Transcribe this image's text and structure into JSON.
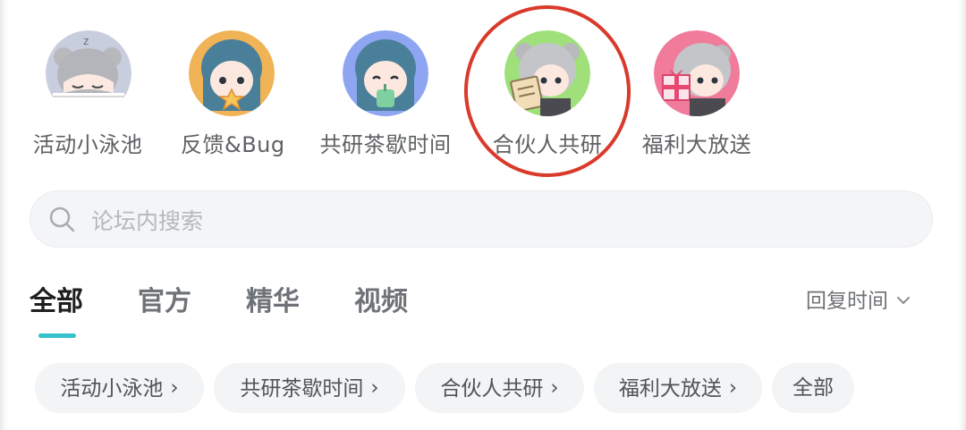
{
  "categories": [
    {
      "label": "活动小泳池",
      "icon": "avatar-sleeping-character",
      "bg": "#c9cede"
    },
    {
      "label": "反馈&Bug",
      "icon": "avatar-character-holding-star",
      "bg": "#f0b355"
    },
    {
      "label": "共研茶歇时间",
      "icon": "avatar-character-drinking-tea",
      "bg": "#8ea6f2"
    },
    {
      "label": "合伙人共研",
      "icon": "avatar-character-with-papers",
      "bg": "#9fe07a",
      "highlighted": true
    },
    {
      "label": "福利大放送",
      "icon": "avatar-character-with-gift",
      "bg": "#f07b9b"
    }
  ],
  "search": {
    "placeholder": "论坛内搜索",
    "value": ""
  },
  "tabs": [
    {
      "label": "全部",
      "active": true
    },
    {
      "label": "官方"
    },
    {
      "label": "精华"
    },
    {
      "label": "视频"
    }
  ],
  "sort": {
    "label": "回复时间"
  },
  "chips": [
    {
      "label": "活动小泳池",
      "arrow": "›"
    },
    {
      "label": "共研茶歇时间",
      "arrow": "›"
    },
    {
      "label": "合伙人共研",
      "arrow": "›"
    },
    {
      "label": "福利大放送",
      "arrow": "›"
    },
    {
      "label": "全部",
      "arrow": ""
    }
  ],
  "colors": {
    "accent": "#35c2cc",
    "highlight_ring": "#d93a2b",
    "tab_active": "#1d1e20",
    "tab_inactive": "#6f7276"
  }
}
